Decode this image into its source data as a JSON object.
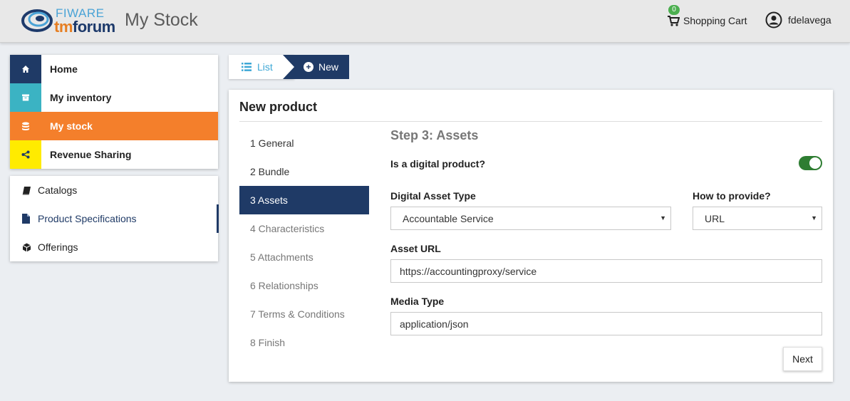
{
  "header": {
    "logo_top": "FIWARE",
    "logo_bottom_a": "tm",
    "logo_bottom_b": "forum",
    "app_title": "My Stock",
    "cart_count": "0",
    "cart_label": "Shopping Cart",
    "user_name": "fdelavega"
  },
  "sidebar": {
    "main": [
      {
        "label": "Home",
        "icon": "home-icon",
        "color": "#1f3a66"
      },
      {
        "label": "My inventory",
        "icon": "archive-icon",
        "color": "#3bb3c3"
      },
      {
        "label": "My stock",
        "icon": "database-icon",
        "color": "#f47f2b"
      },
      {
        "label": "Revenue Sharing",
        "icon": "share-icon",
        "color": "#ffeb00"
      }
    ],
    "sub": [
      {
        "label": "Catalogs",
        "icon": "book-icon"
      },
      {
        "label": "Product Specifications",
        "icon": "file-icon"
      },
      {
        "label": "Offerings",
        "icon": "cube-icon"
      }
    ]
  },
  "breadcrumb": {
    "list": "List",
    "new": "New"
  },
  "form": {
    "title": "New product",
    "steps": [
      "1 General",
      "2 Bundle",
      "3 Assets",
      "4 Characteristics",
      "5 Attachments",
      "6 Relationships",
      "7 Terms & Conditions",
      "8 Finish"
    ],
    "step_title": "Step 3: Assets",
    "digital_label": "Is a digital product?",
    "digital_on": true,
    "asset_type_label": "Digital Asset Type",
    "asset_type_value": "Accountable Service",
    "provide_label": "How to provide?",
    "provide_value": "URL",
    "asset_url_label": "Asset URL",
    "asset_url_value": "https://accountingproxy/service",
    "media_type_label": "Media Type",
    "media_type_value": "application/json",
    "next_label": "Next"
  }
}
